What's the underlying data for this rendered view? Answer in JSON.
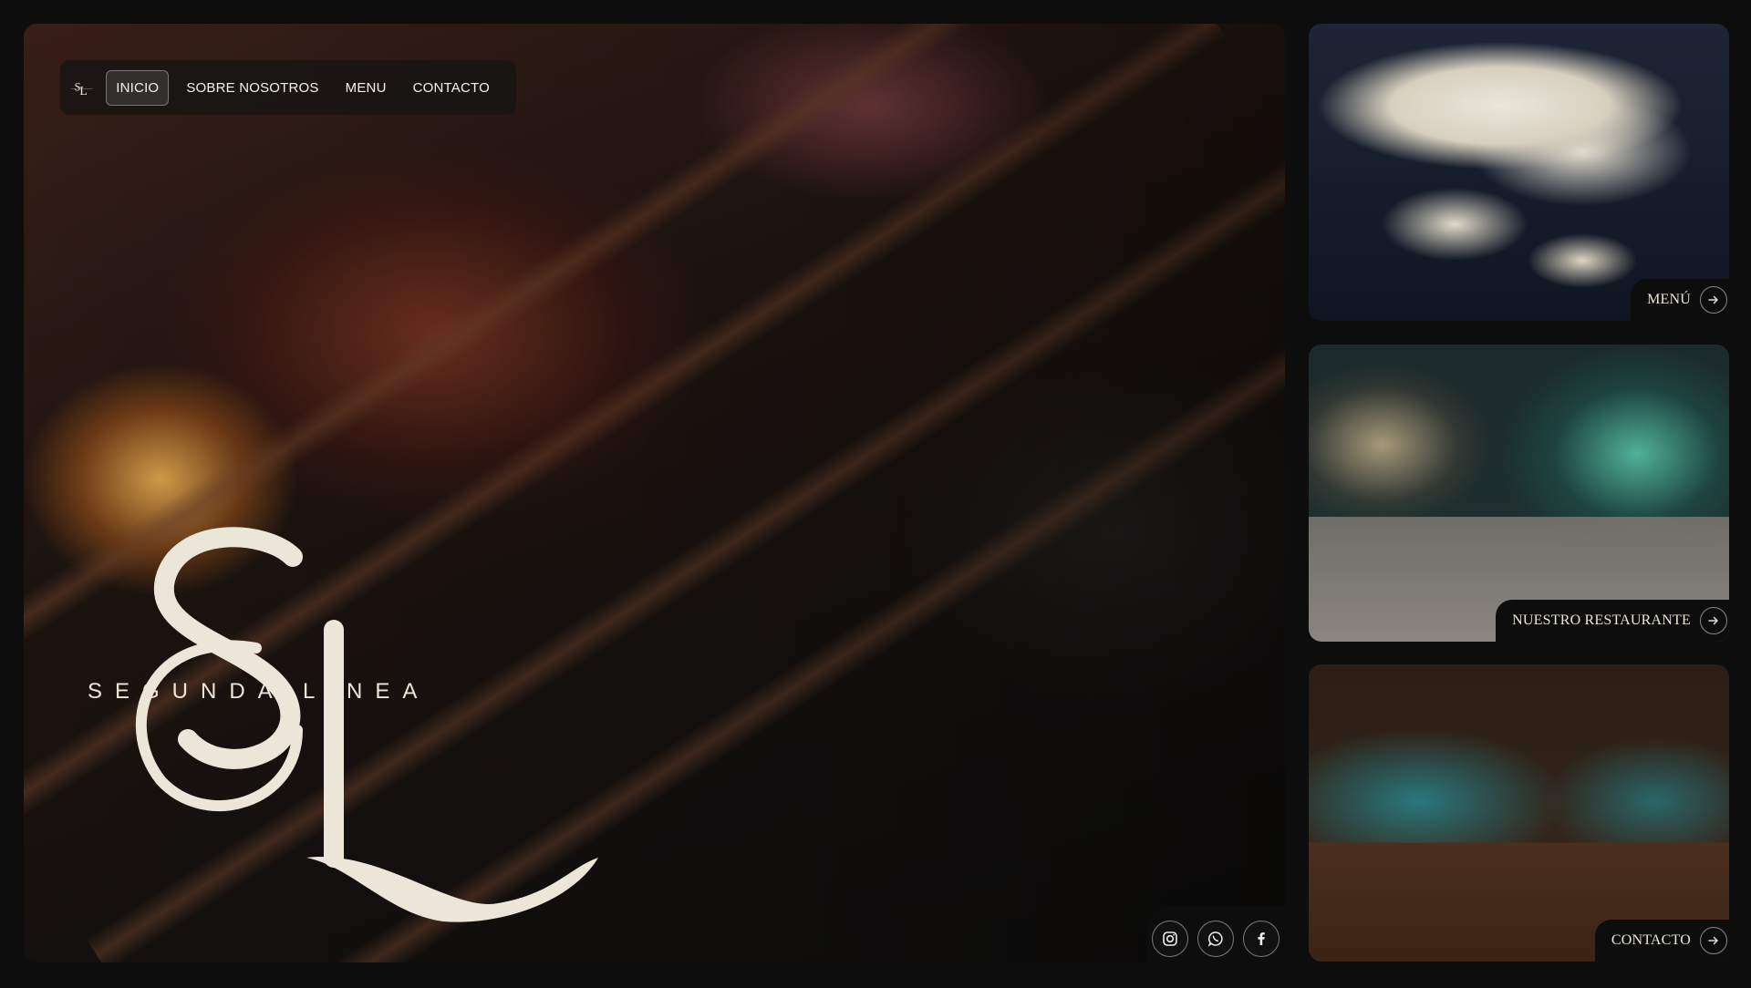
{
  "nav": {
    "logo_alt": "SL",
    "items": [
      {
        "label": "INICIO",
        "active": true
      },
      {
        "label": "SOBRE NOSOTROS",
        "active": false
      },
      {
        "label": "MENU",
        "active": false
      },
      {
        "label": "CONTACTO",
        "active": false
      }
    ]
  },
  "hero": {
    "brand_monogram": "SL",
    "brand_name": "SEGUNDA LINEA",
    "social": [
      {
        "name": "instagram-icon"
      },
      {
        "name": "whatsapp-icon"
      },
      {
        "name": "facebook-icon"
      }
    ]
  },
  "cards": [
    {
      "label": "MENÚ"
    },
    {
      "label": "NUESTRO RESTAURANTE"
    },
    {
      "label": "CONTACTO"
    }
  ],
  "colors": {
    "background": "#0d0d0d",
    "cream": "#ece6d8",
    "nav_bg": "#141414"
  }
}
